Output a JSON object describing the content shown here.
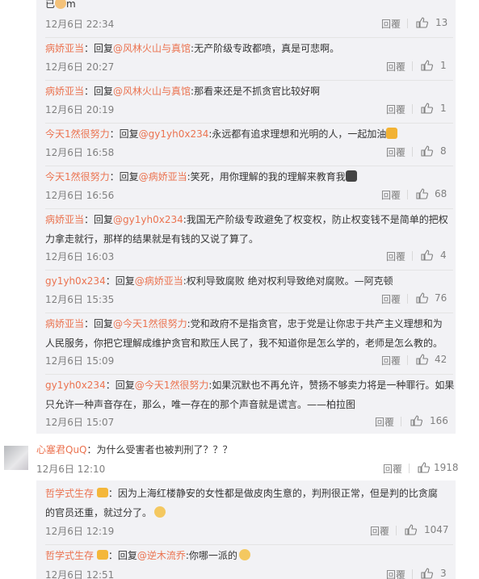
{
  "replies": [
    {
      "pre": "已",
      "user": "",
      "prefix": "",
      "at": "",
      "body": "m",
      "time": "12月6日 22:34",
      "reply": "回覆",
      "likes": "13"
    },
    {
      "user": "病娇亚当",
      "prefix": "：回复",
      "at": "@风林火山与真馆",
      "body": ":无产阶级专政都喷，真是可悲啊。",
      "time": "12月6日 20:27",
      "reply": "回覆",
      "likes": "1"
    },
    {
      "user": "病娇亚当",
      "prefix": "：回复",
      "at": "@风林火山与真馆",
      "body": ":那看来还是不抓贪官比较好啊",
      "time": "12月6日 20:19",
      "reply": "回覆",
      "likes": "1"
    },
    {
      "user": "今天1然很努力",
      "prefix": "：回复",
      "at": "@gy1yh0x234",
      "body": ":永远都有追求理想和光明的人，一起加油",
      "time": "12月6日 16:58",
      "reply": "回覆",
      "likes": "8"
    },
    {
      "user": "今天1然很努力",
      "prefix": "：回复",
      "at": "@病娇亚当",
      "body": ":笑死，用你理解的我的理解来教育我",
      "time": "12月6日 16:56",
      "reply": "回覆",
      "likes": "68"
    },
    {
      "user": "病娇亚当",
      "prefix": "：回复",
      "at": "@gy1yh0x234",
      "body": ":我国无产阶级专政避免了权变权，防止权变钱不是简单的把权",
      "body2": "力拿走就行，那样的结果就是有钱的又说了算了。",
      "time": "12月6日 16:03",
      "reply": "回覆",
      "likes": "4"
    },
    {
      "user": "gy1yh0x234",
      "prefix": "：回复",
      "at": "@病娇亚当",
      "body": ":权利导致腐败 绝对权利导致绝对腐败。—阿克顿",
      "time": "12月6日 15:35",
      "reply": "回覆",
      "likes": "76"
    },
    {
      "user": "病娇亚当",
      "prefix": "：回复",
      "at": "@今天1然很努力",
      "body": ":党和政府不是指贪官，忠于党是让你忠于共产主义理想和为",
      "body2": "人民服务，你把它理解成维护贪官和欺压人民了，我不知道你是怎么学的，老师是怎么教的。",
      "time": "12月6日 15:09",
      "reply": "回覆",
      "likes": "42"
    },
    {
      "user": "gy1yh0x234",
      "prefix": "：回复",
      "at": "@今天1然很努力",
      "body": ":如果沉默也不再允许，赞扬不够卖力将是一种罪行。如果",
      "body2": "只允许一种声音存在，那么，唯一存在的那个声音就是谎言。——柏拉图",
      "time": "12月6日 15:07",
      "reply": "回覆",
      "likes": "166"
    }
  ],
  "comment": {
    "user": "心塞君QuQ",
    "body": "：为什么受害者也被判刑了？？？",
    "time": "12月6日 12:10",
    "reply": "回覆",
    "likes": "1918"
  },
  "subreplies": [
    {
      "user": "哲学式生存",
      "prefix": "：",
      "at": "",
      "body": "因为上海红楼静安的女性都是做皮肉生意的，判刑很正常，但是判的比贪腐",
      "body2": "的官员还重，就过分了。",
      "time": "12月6日 12:19",
      "reply": "回覆",
      "likes": "1047"
    },
    {
      "user": "哲学式生存",
      "prefix": "：回复",
      "at": "@逆木流乔",
      "body": ":你哪一派的",
      "time": "12月6日 12:51",
      "reply": "回覆",
      "likes": "3"
    }
  ]
}
